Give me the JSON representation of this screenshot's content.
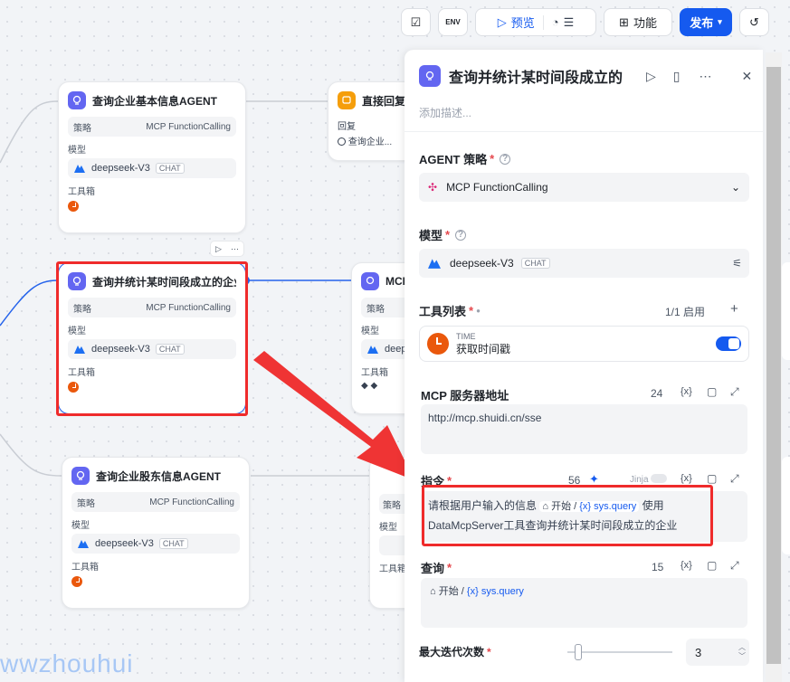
{
  "toolbar": {
    "env": "ENV",
    "preview": "预览",
    "features": "功能",
    "publish": "发布"
  },
  "nodes": {
    "n1": {
      "title": "查询企业基本信息AGENT",
      "strategy_label": "策略",
      "strategy": "MCP FunctionCalling",
      "model_label": "模型",
      "model": "deepseek-V3",
      "model_tag": "CHAT",
      "tools_label": "工具箱"
    },
    "n2": {
      "title": "查询并统计某时间段成立的企业",
      "strategy_label": "策略",
      "strategy": "MCP FunctionCalling",
      "model_label": "模型",
      "model": "deepseek-V3",
      "model_tag": "CHAT",
      "tools_label": "工具箱"
    },
    "n3": {
      "title": "查询企业股东信息AGENT",
      "strategy_label": "策略",
      "strategy": "MCP FunctionCalling",
      "model_label": "模型",
      "model": "deepseek-V3",
      "model_tag": "CHAT",
      "tools_label": "工具箱"
    },
    "reply": {
      "title": "直接回复",
      "sub": "回复",
      "ref": "查询企业..."
    },
    "m1": {
      "title": "MCP",
      "strategy_label": "策略",
      "model_label": "模型",
      "model": "deep",
      "tools_label": "工具箱"
    },
    "m2": {
      "strategy_label": "策略",
      "model_label": "模型",
      "tools_label": "工具箱"
    }
  },
  "panel": {
    "title": "查询并统计某时间段成立的",
    "desc_placeholder": "添加描述...",
    "strategy_label": "AGENT 策略",
    "strategy_value": "MCP FunctionCalling",
    "model_label": "模型",
    "model_value": "deepseek-V3",
    "model_tag": "CHAT",
    "tools_label": "工具列表",
    "tools_count": "1/1 启用",
    "tool_provider": "TIME",
    "tool_name": "获取时间戳",
    "tool_enabled": true,
    "mcp_label": "MCP 服务器地址",
    "mcp_count": "24",
    "mcp_value": "http://mcp.shuidi.cn/sse",
    "instr_label": "指令",
    "instr_count": "56",
    "jinja": "Jinja",
    "instr_text1": "请根据用户输入的信息",
    "instr_var_src": "开始",
    "instr_var": "sys.query",
    "instr_text2": "使用",
    "instr_text3": "DataMcpServer工具查询并统计某时间段成立的企业",
    "query_label": "查询",
    "query_count": "15",
    "query_var_src": "开始",
    "query_var": "sys.query",
    "iter_label": "最大迭代次数",
    "iter_value": "3",
    "var_icon": "{x}"
  },
  "watermark": "wwzhouhui",
  "colors": {
    "accent": "#155aef",
    "agent": "#6366f1",
    "red": "#ef2b2b",
    "clock": "#ea580c"
  }
}
